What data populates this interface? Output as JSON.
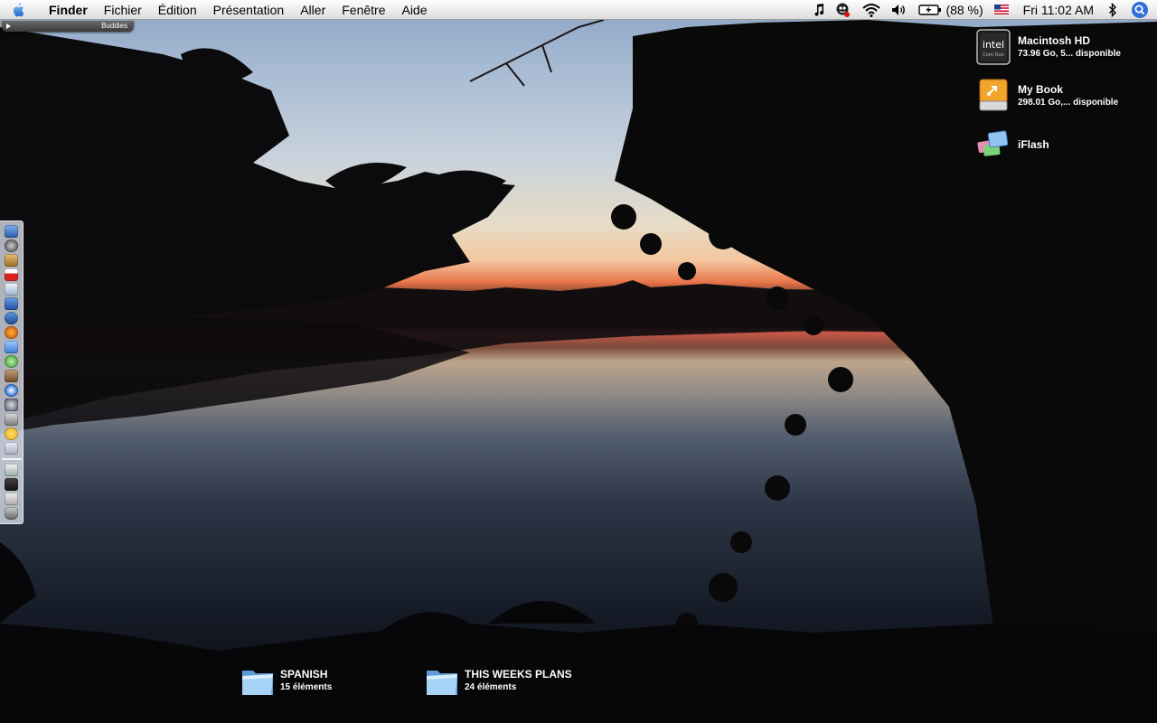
{
  "menubar": {
    "app_name": "Finder",
    "items": [
      "Fichier",
      "Édition",
      "Présentation",
      "Aller",
      "Fenêtre",
      "Aide"
    ],
    "status": {
      "battery": "(88 %)",
      "clock": "Fri 11:02 AM",
      "icons": [
        "music-note-icon",
        "cowbell-icon",
        "wifi-icon",
        "volume-icon",
        "battery-icon",
        "us-flag-icon",
        "bluetooth-icon",
        "spotlight-icon"
      ]
    }
  },
  "drawer": {
    "label": "Buddies"
  },
  "volumes": [
    {
      "name": "Macintosh HD",
      "info": "73.96 Go, 5... disponible",
      "icon": "intel-hard-drive-icon"
    },
    {
      "name": "My Book",
      "info": "298.01 Go,... disponible",
      "icon": "external-drive-icon"
    },
    {
      "name": "iFlash",
      "info": "",
      "icon": "flash-drive-icon"
    }
  ],
  "folders": [
    {
      "name": "SPANISH",
      "count": "15 éléments"
    },
    {
      "name": "THIS WEEKS PLANS",
      "count": "24 éléments"
    }
  ],
  "drive_badge": {
    "line1": "intel",
    "line2": "Core Duo"
  },
  "colors": {
    "folder_blue": "#8fc4ee",
    "spotlight_blue": "#2f6fd8",
    "mybook_orange": "#f3a42b"
  }
}
